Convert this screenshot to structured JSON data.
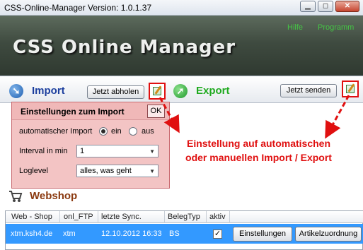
{
  "window": {
    "title": "CSS-Online-Manager Version: 1.0.1.37",
    "minimize": "▁",
    "restore": "◻",
    "close": "✕"
  },
  "banner": {
    "logo_text": "CSS Online Manager",
    "links": [
      "Hilfe",
      "Programm"
    ]
  },
  "import": {
    "title": "Import",
    "button": "Jetzt abholen"
  },
  "export": {
    "title": "Export",
    "button": "Jetzt senden"
  },
  "settings_popup": {
    "title": "Einstellungen zum Import",
    "ok_label": "OK",
    "auto_import_label": "automatischer Import",
    "radio_on_label": "ein",
    "radio_off_label": "aus",
    "selected_radio": "ein",
    "interval_label": "Interval in min",
    "interval_value": "1",
    "loglevel_label": "Loglevel",
    "loglevel_value": "alles, was geht"
  },
  "callout": {
    "line1": "Einstellung auf automatischen",
    "line2": "oder manuellen Import / Export"
  },
  "webshop": {
    "title": "Webshop",
    "columns": [
      "Web - Shop",
      "onl_FTP",
      "letzte Sync.",
      "BelegTyp",
      "aktiv"
    ],
    "row": {
      "shop": "xtm.ksh4.de",
      "ftp": "xtm",
      "last_sync": "12.10.2012 16:33",
      "belegtyp": "BS",
      "aktiv": true
    },
    "row_buttons": [
      "Einstellungen",
      "Artikelzuordnung"
    ]
  },
  "colors": {
    "highlight_red": "#e01010",
    "banner_green": "#45c645",
    "selection_blue": "#3399ff",
    "popup_pink": "#f3c4c4"
  }
}
